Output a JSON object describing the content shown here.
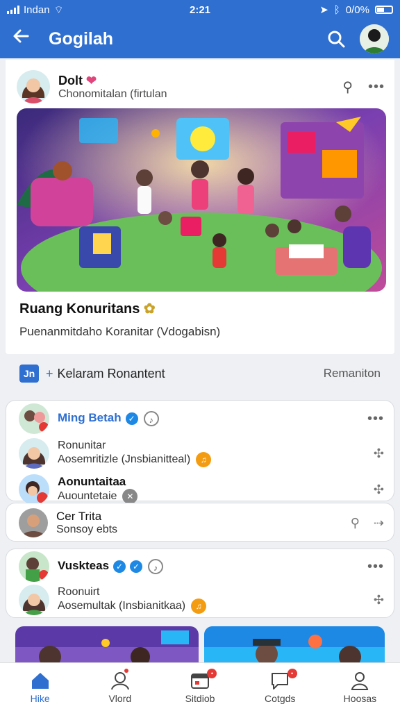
{
  "status": {
    "carrier": "Indan",
    "time": "2:21",
    "battery": "0/0%"
  },
  "appbar": {
    "title": "Gogilah",
    "back_icon": "back-arrow-icon",
    "search_icon": "search-icon"
  },
  "post": {
    "author": "Dolt",
    "subtitle": "Chonomitalan (firtulan",
    "title": "Ruang Konuritans",
    "description": "Puenanmitdaho Koranitar (Vdogabisn)"
  },
  "actionbar": {
    "chip": "Jn",
    "label": "Kelaram Ronantent",
    "right": "Remaniton"
  },
  "group1": {
    "header": "Ming Betah",
    "items": [
      {
        "name": "Ronunitar",
        "sub": "Aosemritizle (Jnsbianitteal)"
      },
      {
        "name": "Aonuntaitaa",
        "sub": "Auountetaie"
      }
    ]
  },
  "single": {
    "name": "Cer Trita",
    "sub": "Sonsoy ebts"
  },
  "group2": {
    "header": "Vuskteas",
    "items": [
      {
        "name": "Roonuirt",
        "sub": "Aosemultak (Insbianitkaa)"
      }
    ]
  },
  "nav": [
    {
      "label": "Hike",
      "icon": "home-icon"
    },
    {
      "label": "Vlord",
      "icon": "profile-icon"
    },
    {
      "label": "Sitdiob",
      "icon": "calendar-icon"
    },
    {
      "label": "Cotgds",
      "icon": "chat-icon"
    },
    {
      "label": "Hoosas",
      "icon": "user-icon"
    }
  ],
  "colors": {
    "primary": "#2f6fd0",
    "verified": "#1e88e5",
    "badge": "#e53935"
  }
}
